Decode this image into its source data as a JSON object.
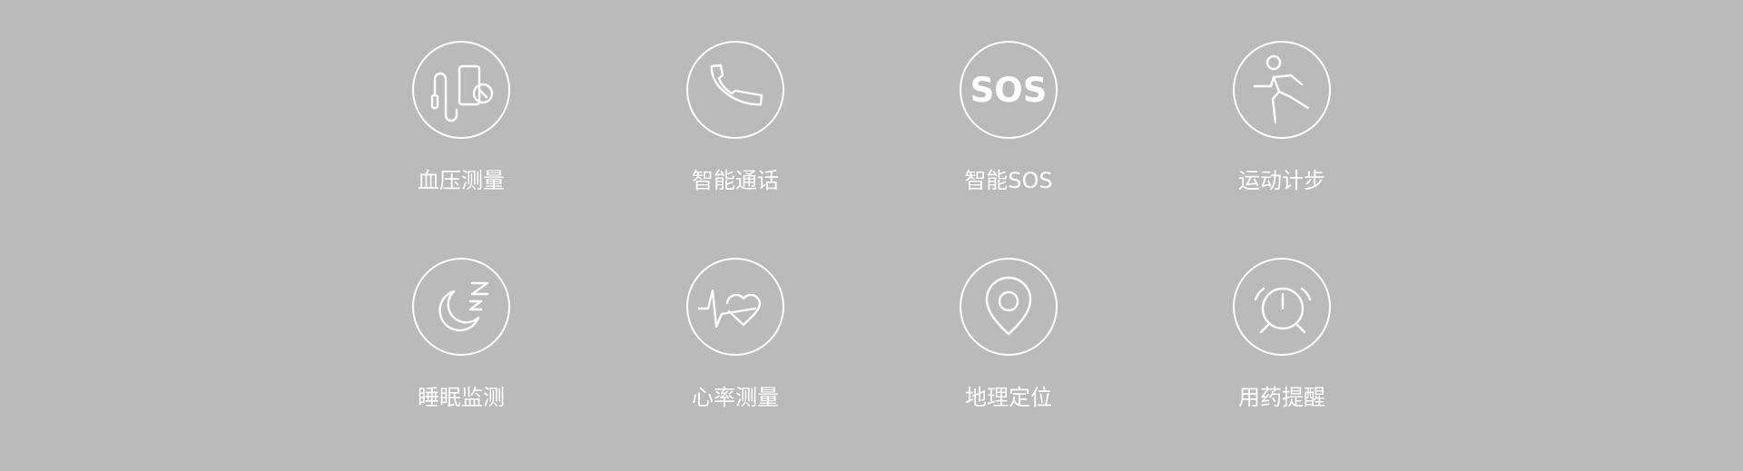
{
  "theme": {
    "background": "#bababa",
    "foreground": "#ffffff"
  },
  "features": [
    {
      "label": "血压测量",
      "icon": "blood-pressure-icon"
    },
    {
      "label": "智能通话",
      "icon": "phone-icon"
    },
    {
      "label": "智能SOS",
      "icon": "sos-icon",
      "icon_text": "SOS"
    },
    {
      "label": "运动计步",
      "icon": "running-icon"
    },
    {
      "label": "睡眠监测",
      "icon": "sleep-icon"
    },
    {
      "label": "心率测量",
      "icon": "heart-rate-icon"
    },
    {
      "label": "地理定位",
      "icon": "location-pin-icon"
    },
    {
      "label": "用药提醒",
      "icon": "alarm-clock-icon"
    }
  ]
}
